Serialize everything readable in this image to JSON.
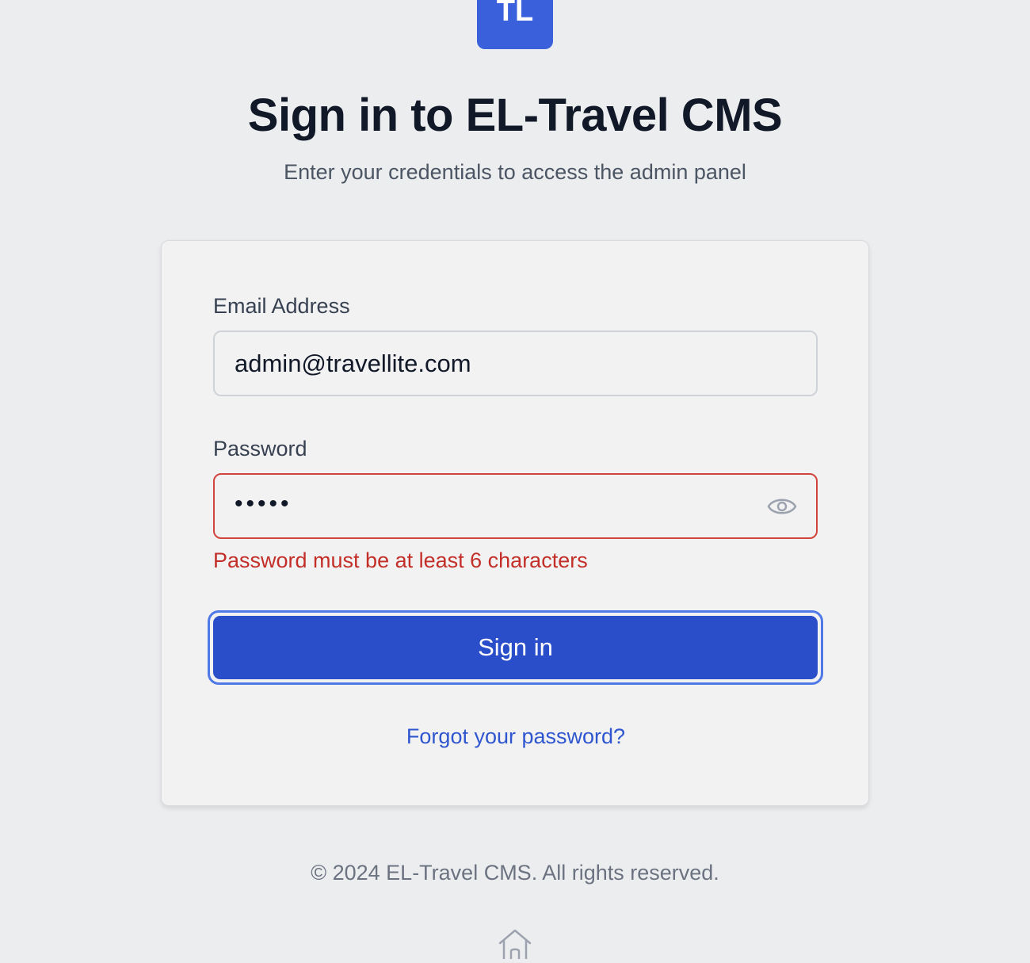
{
  "logo": {
    "text": "TL"
  },
  "header": {
    "title": "Sign in to EL-Travel CMS",
    "subtitle": "Enter your credentials to access the admin panel"
  },
  "form": {
    "email_label": "Email Address",
    "email_value": "admin@travellite.com",
    "password_label": "Password",
    "password_value": "•••••",
    "password_error": "Password must be at least 6 characters",
    "submit_label": "Sign in",
    "forgot_label": "Forgot your password?"
  },
  "footer": {
    "text": "© 2024 EL-Travel CMS. All rights reserved."
  },
  "icons": {
    "password_toggle": "eye-icon",
    "home": "home-icon"
  },
  "colors": {
    "brand": "#3a60dc",
    "primary_button": "#2a4dc9",
    "link": "#2f56cf",
    "error": "#c32f28"
  }
}
